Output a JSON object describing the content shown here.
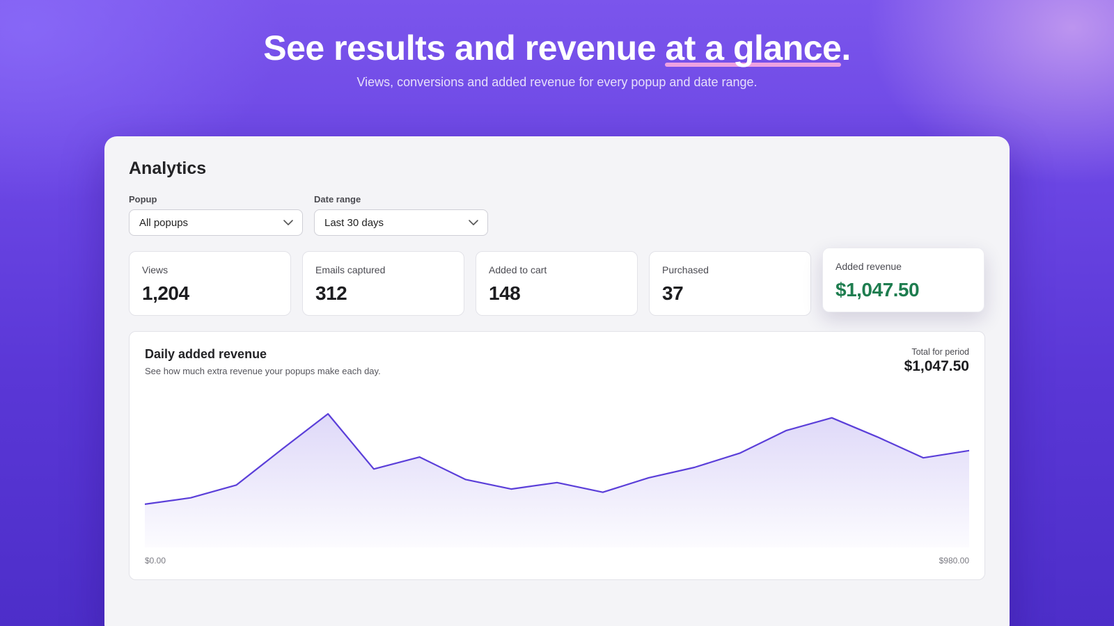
{
  "hero": {
    "title_main": "See results and revenue ",
    "title_highlight": "at a glance",
    "title_end": ".",
    "subtitle": "Views, conversions and added revenue for every popup and date range."
  },
  "panel": {
    "title": "Analytics",
    "filters": {
      "popup_label": "Popup",
      "popup_value": "All popups",
      "date_label": "Date range",
      "date_value": "Last 30 days"
    },
    "stats": [
      {
        "label": "Views",
        "value": "1,204"
      },
      {
        "label": "Emails captured",
        "value": "312"
      },
      {
        "label": "Added to cart",
        "value": "148"
      },
      {
        "label": "Purchased",
        "value": "37"
      },
      {
        "label": "Added revenue",
        "value": "$1,047.50"
      }
    ],
    "chart": {
      "title": "Daily added revenue",
      "subtitle": "See how much extra revenue your popups make each day.",
      "total_label": "Total for period",
      "total_value": "$1,047.50",
      "axis_left": "$0.00",
      "axis_right": "$980.00"
    }
  },
  "colors": {
    "accent": "#5b3fd9",
    "revenue_green": "#1e7d4f",
    "highlight_underline": "#f4a6e0"
  },
  "chart_data": {
    "type": "area",
    "x": [
      1,
      2,
      3,
      4,
      5,
      6,
      7,
      8,
      9,
      10,
      11,
      12,
      13,
      14,
      15,
      16,
      17,
      18,
      19,
      20
    ],
    "values": [
      54,
      62,
      78,
      123,
      167,
      98,
      113,
      85,
      73,
      81,
      69,
      87,
      100,
      118,
      146,
      162,
      138,
      112,
      121
    ],
    "ylim": [
      0,
      200
    ],
    "grid": false,
    "title": "Daily added revenue",
    "xlabel": "",
    "ylabel": ""
  }
}
